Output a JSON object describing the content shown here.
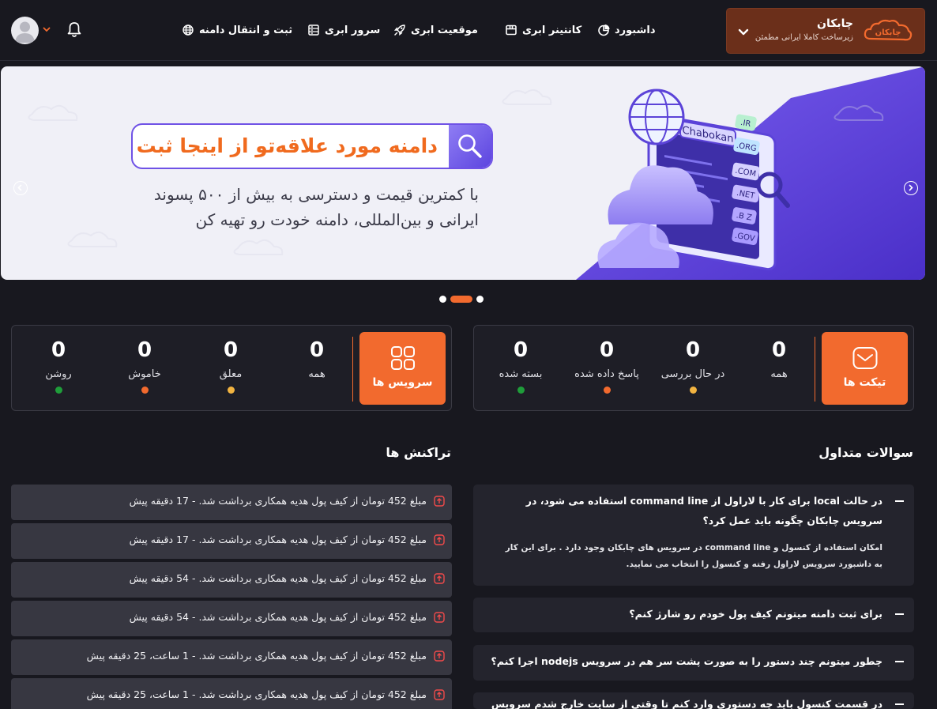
{
  "brand": {
    "name": "چابکان",
    "tagline": "زیرساخت کاملا ایرانی مطمئن",
    "logo_text": "چابکان",
    "bg_color": "#6b2f1a"
  },
  "nav": {
    "dashboard": "داشبورد",
    "container": "کانتینر ابری",
    "location": "موقعیت ابری",
    "server": "سرور ابری",
    "domain": "ثبت و انتقال دامنه"
  },
  "banner": {
    "search_text": "دامنه مورد علاقه‌تو از اینجا ثبت کن",
    "subtitle_line1": "با کمترین قیمت و دسترسی به بیش از ۵۰۰ پسوند",
    "subtitle_line2": "ایرانی و بین‌المللی، دامنه خودت رو تهیه کن",
    "screen_title": "Chabokan",
    "tlds": [
      ".IR",
      ".ORG",
      ".COM",
      ".NET",
      ".B Z",
      ".GOV"
    ],
    "active_slide": 2,
    "slide_count": 3
  },
  "tickets": {
    "label": "تیکت ها",
    "stats": [
      {
        "label": "همه",
        "value": "0",
        "dot": ""
      },
      {
        "label": "در حال بررسی",
        "value": "0",
        "dot": "#f2b441"
      },
      {
        "label": "پاسخ داده شده",
        "value": "0",
        "dot": "#f26a2e"
      },
      {
        "label": "بسته شده",
        "value": "0",
        "dot": "#1f9d3a"
      }
    ]
  },
  "services": {
    "label": "سرویس ها",
    "stats": [
      {
        "label": "همه",
        "value": "0",
        "dot": ""
      },
      {
        "label": "معلق",
        "value": "0",
        "dot": "#f2b441"
      },
      {
        "label": "خاموش",
        "value": "0",
        "dot": "#f26a2e"
      },
      {
        "label": "روشن",
        "value": "0",
        "dot": "#1f9d3a"
      }
    ]
  },
  "faq": {
    "title": "سوالات متداول",
    "items": [
      {
        "question": "در حالت local برای کار با لاراول از command line استفاده می شود، در سرویس چابکان چگونه باید عمل کرد؟",
        "answer": "امکان استفاده از کنسول و command line در سرویس های چابکان وجود دارد . برای این کار به داشبورد سرویس لاراول رفته و کنسول را انتخاب می نمایید."
      },
      {
        "question": "برای ثبت دامنه میتونم کیف پول خودم رو شارژ کنم؟"
      },
      {
        "question": "چطور میتونم چند دستور را به صورت پشت سر هم در سرویس nodejs اجرا کنم؟"
      },
      {
        "question": "در قسمت کنسول باید چه دستوری وارد کنم تا وقتی از سایت خارج شدم سرویس غیرفعال نشود؟"
      }
    ]
  },
  "transactions": {
    "title": "تراکنش ها",
    "items": [
      "مبلغ 452 تومان از کیف پول هدیه همکاری برداشت شد. - 17 دقیقه پیش",
      "مبلغ 452 تومان از کیف پول هدیه همکاری برداشت شد. - 17 دقیقه پیش",
      "مبلغ 452 تومان از کیف پول هدیه همکاری برداشت شد. - 54 دقیقه پیش",
      "مبلغ 452 تومان از کیف پول هدیه همکاری برداشت شد. - 54 دقیقه پیش",
      "مبلغ 452 تومان از کیف پول هدیه همکاری برداشت شد. - 1 ساعت، 25 دقیقه پیش",
      "مبلغ 452 تومان از کیف پول هدیه همکاری برداشت شد. - 1 ساعت، 25 دقیقه پیش"
    ]
  },
  "colors": {
    "accent": "#f26a2e",
    "background": "#18181f",
    "card": "#1e1e26",
    "row": "#373741"
  }
}
